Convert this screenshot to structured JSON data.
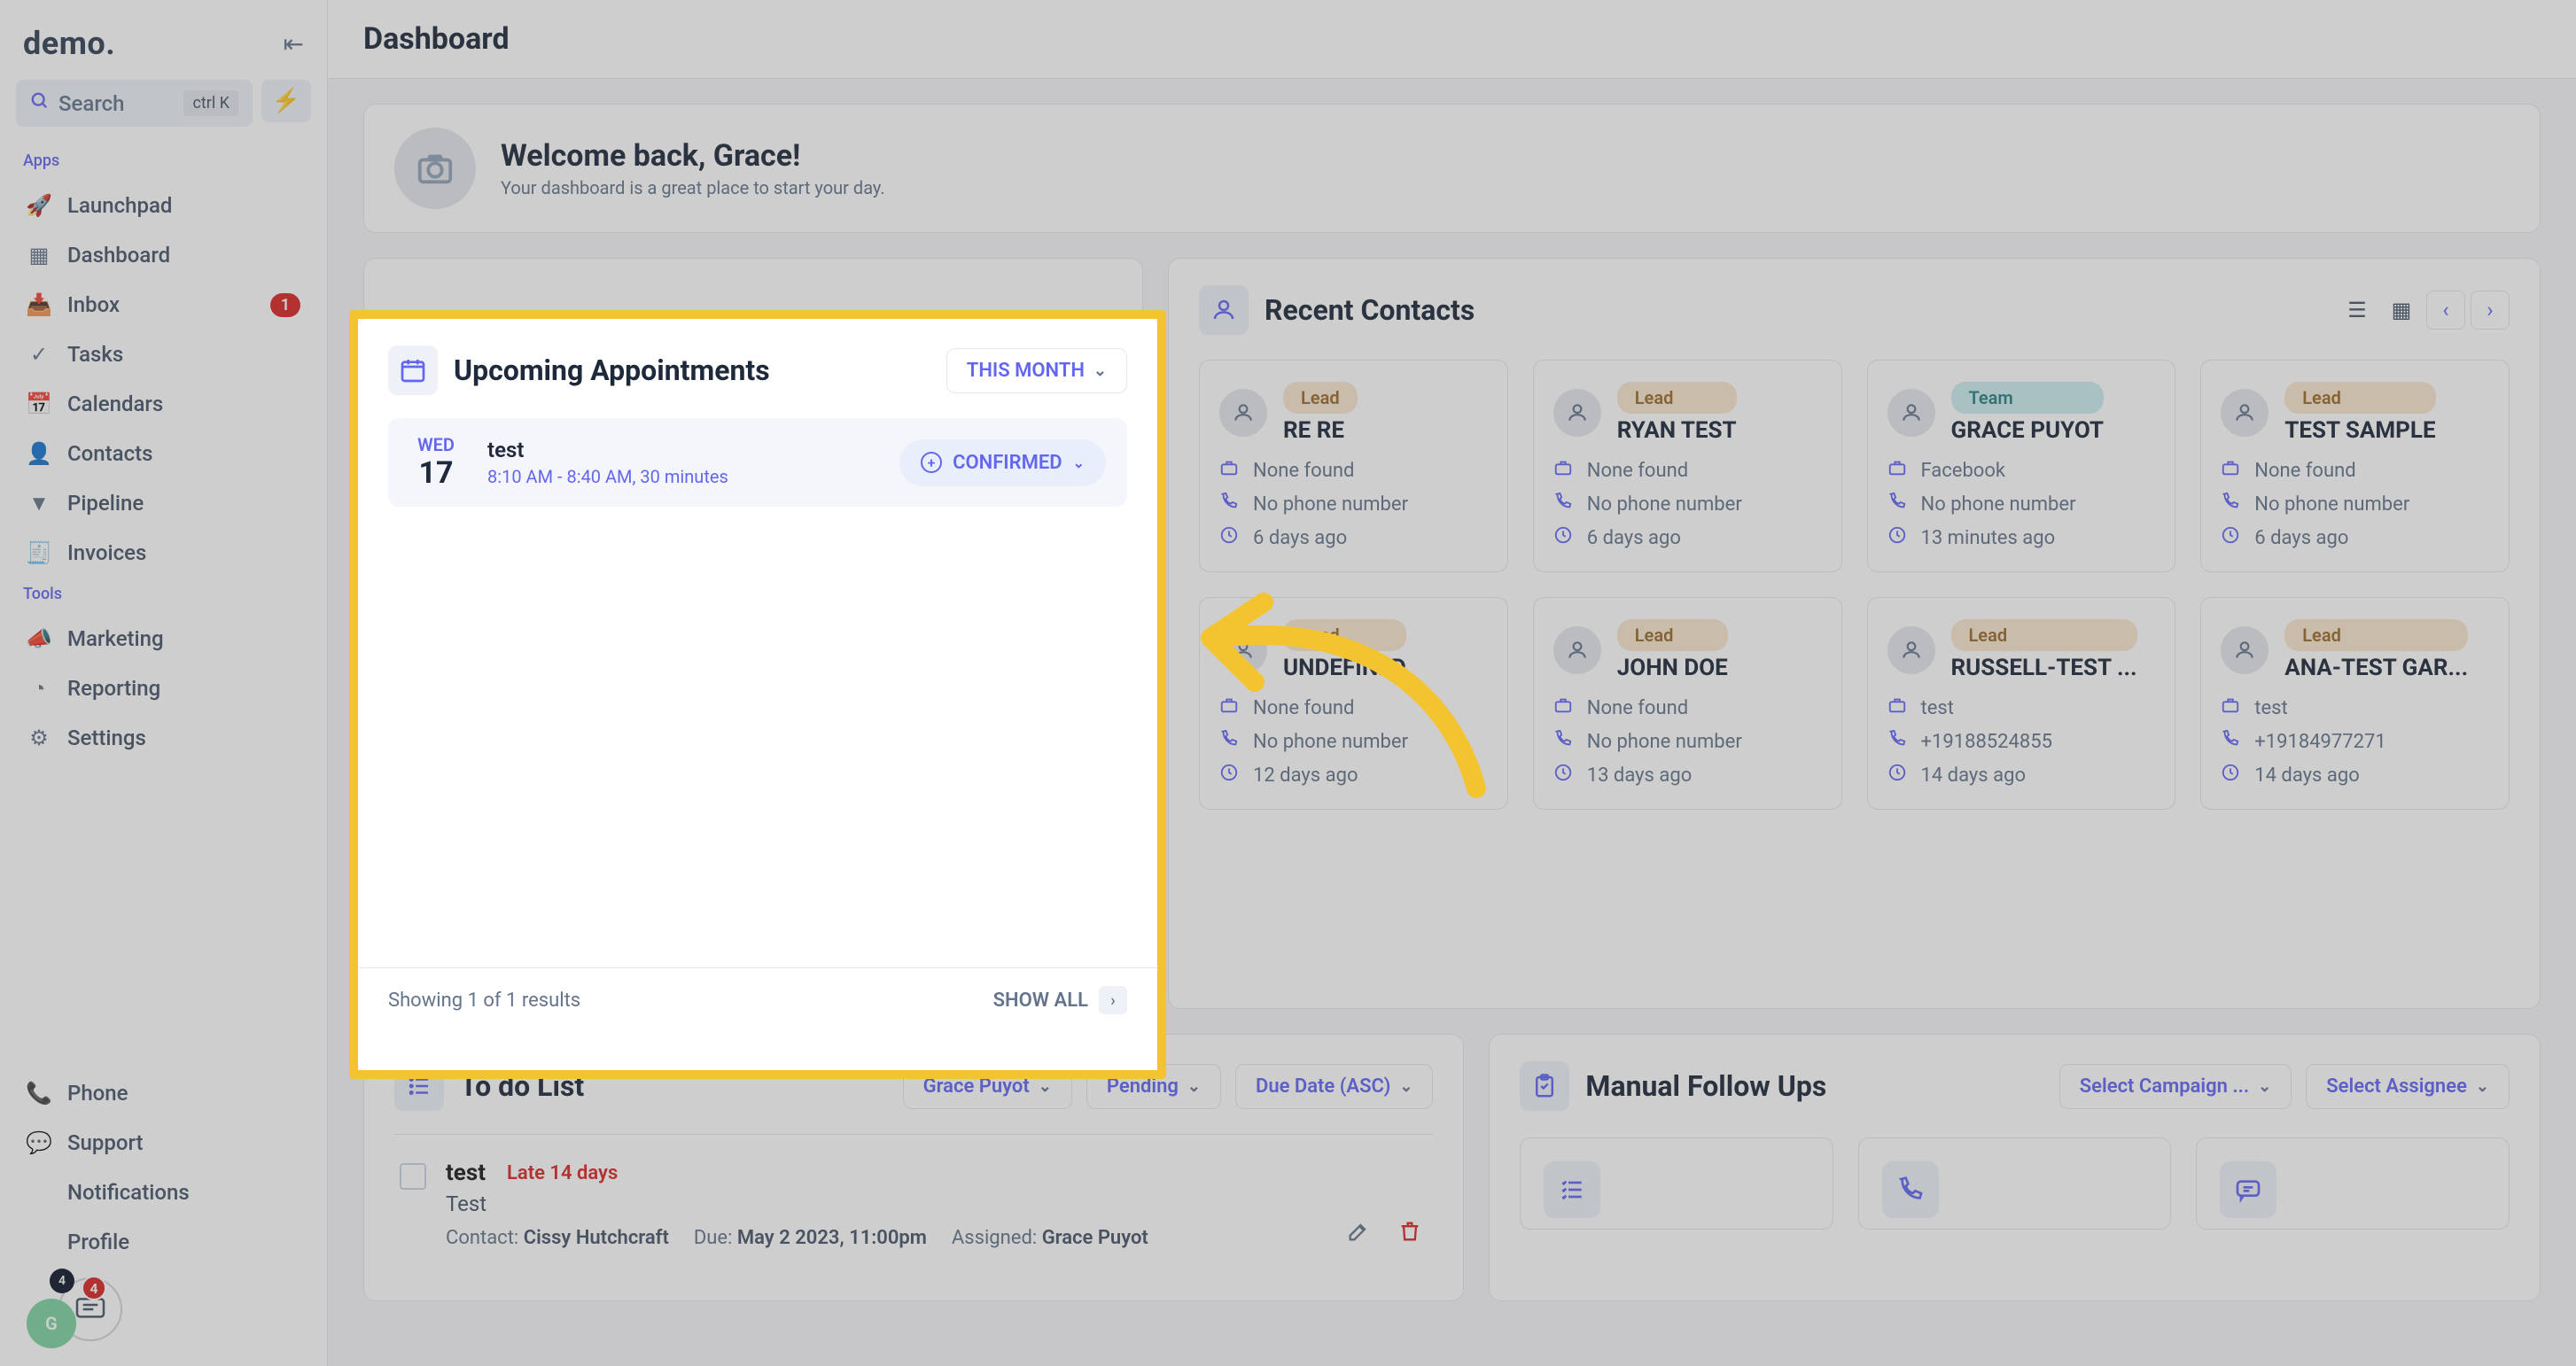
{
  "logo": "demo.",
  "search": {
    "label": "Search",
    "kbd": "ctrl K"
  },
  "sidebar": {
    "apps_label": "Apps",
    "tools_label": "Tools",
    "items": [
      {
        "label": "Launchpad"
      },
      {
        "label": "Dashboard"
      },
      {
        "label": "Inbox",
        "badge": "1"
      },
      {
        "label": "Tasks"
      },
      {
        "label": "Calendars"
      },
      {
        "label": "Contacts"
      },
      {
        "label": "Pipeline"
      },
      {
        "label": "Invoices"
      }
    ],
    "tools": [
      {
        "label": "Marketing"
      },
      {
        "label": "Reporting"
      },
      {
        "label": "Settings"
      }
    ],
    "bottom": [
      {
        "label": "Phone"
      },
      {
        "label": "Support"
      },
      {
        "label": "Notifications"
      },
      {
        "label": "Profile"
      }
    ],
    "avatar_initials": "G",
    "chat_badge": "4",
    "dark_badge": "4"
  },
  "page_title": "Dashboard",
  "welcome": {
    "title": "Welcome back, Grace!",
    "subtitle": "Your dashboard is a great place to start your day."
  },
  "appointments": {
    "title": "Upcoming Appointments",
    "range_label": "THIS MONTH",
    "items": [
      {
        "dow": "WED",
        "day": "17",
        "title": "test",
        "time": "8:10 AM - 8:40 AM, 30 minutes",
        "status": "CONFIRMED"
      }
    ],
    "footer": "Showing 1 of 1 results",
    "show_all": "SHOW ALL"
  },
  "contacts": {
    "title": "Recent Contacts",
    "cards": [
      {
        "tag": "Lead",
        "tag_type": "lead",
        "name": "RE RE",
        "source": "None found",
        "phone": "No phone number",
        "when": "6 days ago"
      },
      {
        "tag": "Lead",
        "tag_type": "lead",
        "name": "RYAN TEST",
        "source": "None found",
        "phone": "No phone number",
        "when": "6 days ago"
      },
      {
        "tag": "Team",
        "tag_type": "team",
        "name": "GRACE PUYOT",
        "source": "Facebook",
        "phone": "No phone number",
        "when": "13 minutes ago"
      },
      {
        "tag": "Lead",
        "tag_type": "lead",
        "name": "TEST SAMPLE",
        "source": "None found",
        "phone": "No phone number",
        "when": "6 days ago"
      },
      {
        "tag": "Lead",
        "tag_type": "lead",
        "name": "UNDEFINED",
        "source": "None found",
        "phone": "No phone number",
        "when": "12 days ago"
      },
      {
        "tag": "Lead",
        "tag_type": "lead",
        "name": "JOHN DOE",
        "source": "None found",
        "phone": "No phone number",
        "when": "13 days ago"
      },
      {
        "tag": "Lead",
        "tag_type": "lead",
        "name": "RUSSELL-TEST ...",
        "source": "test",
        "phone": "+19188524855",
        "when": "14 days ago"
      },
      {
        "tag": "Lead",
        "tag_type": "lead",
        "name": "ANA-TEST GAR...",
        "source": "test",
        "phone": "+19184977271",
        "when": "14 days ago"
      }
    ]
  },
  "todo": {
    "title": "To do List",
    "filters": {
      "assignee": "Grace Puyot",
      "status": "Pending",
      "sort": "Due Date (ASC)"
    },
    "items": [
      {
        "title": "test",
        "late": "Late 14 days",
        "subtitle": "Test",
        "contact_label": "Contact:",
        "contact": "Cissy Hutchcraft",
        "due_label": "Due:",
        "due": "May 2 2023, 11:00pm",
        "assigned_label": "Assigned:",
        "assigned": "Grace Puyot"
      }
    ]
  },
  "followups": {
    "title": "Manual Follow Ups",
    "campaign_label": "Select Campaign ...",
    "assignee_label": "Select Assignee"
  }
}
